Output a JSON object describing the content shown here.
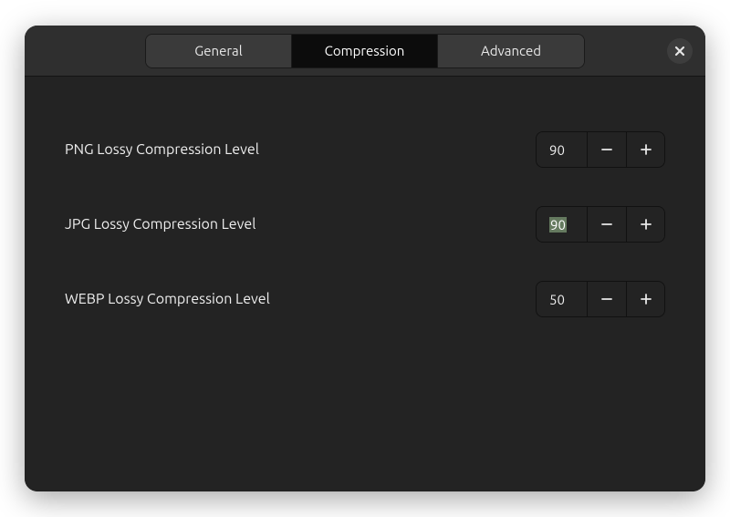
{
  "header": {
    "tabs": [
      {
        "label": "General",
        "active": false
      },
      {
        "label": "Compression",
        "active": true
      },
      {
        "label": "Advanced",
        "active": false
      }
    ],
    "close_icon": "close-icon"
  },
  "settings": [
    {
      "label": "PNG Lossy Compression Level",
      "value": "90",
      "selected": false
    },
    {
      "label": "JPG Lossy Compression Level",
      "value": "90",
      "selected": true
    },
    {
      "label": "WEBP Lossy Compression Level",
      "value": "50",
      "selected": false
    }
  ]
}
